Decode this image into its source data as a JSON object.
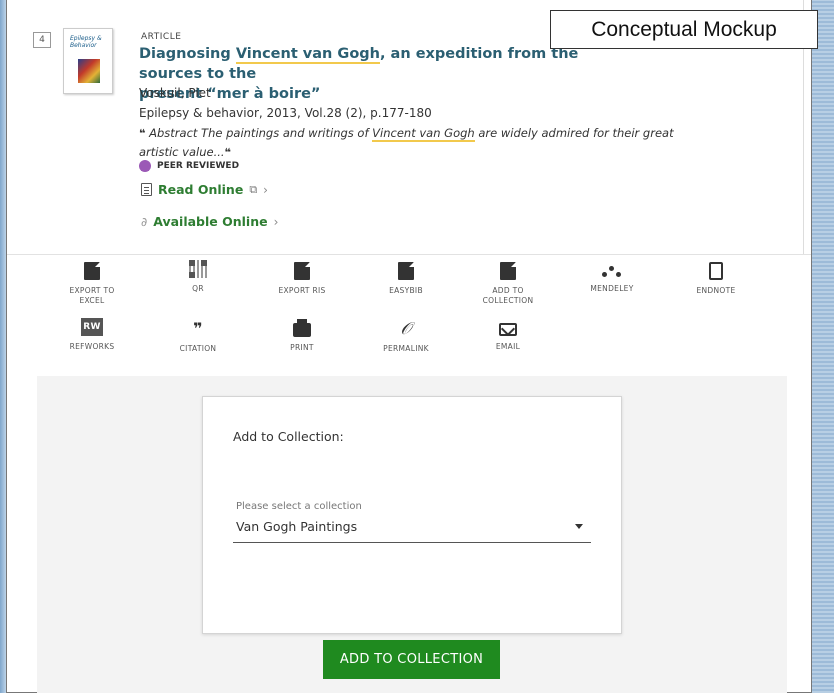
{
  "overlay": {
    "label": "Conceptual Mockup"
  },
  "result": {
    "number": "4",
    "thumbnail_title": "Epilepsy & Behavior",
    "type": "ARTICLE",
    "title_prefix": "Diagnosing ",
    "title_highlight": "Vincent van Gogh",
    "title_line1_suffix": ", an expedition from the sources to the",
    "title_line2": "present “mer à boire”",
    "author": "Voskuil, Piet",
    "publication": "Epilepsy & behavior, 2013, Vol.28 (2), p.177-180",
    "abstract_prefix": " Abstract The paintings and writings of ",
    "abstract_highlight": "Vincent van Gogh",
    "abstract_suffix": " are widely admired for their great artistic value...",
    "quote_open": "❝",
    "quote_close": "❝",
    "peer_reviewed": "PEER REVIEWED",
    "read_online": "Read Online",
    "available_online": "Available Online"
  },
  "actions": {
    "export_excel": "EXPORT TO EXCEL",
    "qr": "QR",
    "export_ris": "EXPORT RIS",
    "easybib": "EASYBIB",
    "add_to_collection": "ADD TO COLLECTION",
    "mendeley": "MENDELEY",
    "endnote": "ENDNOTE",
    "refworks": "REFWORKS",
    "refworks_icon": "RW",
    "citation": "CITATION",
    "print": "PRINT",
    "permalink": "PERMALINK",
    "email": "EMAIL"
  },
  "collection_dialog": {
    "title": "Add to  Collection:",
    "select_label": "Please select a collection",
    "select_value": "Van Gogh Paintings",
    "button": "ADD TO COLLECTION"
  },
  "colors": {
    "title": "#2b5f72",
    "link_green": "#2e7d32",
    "button_green": "#1f8a1f",
    "highlight": "#f2c94c",
    "peer_purple": "#9b59b6"
  }
}
